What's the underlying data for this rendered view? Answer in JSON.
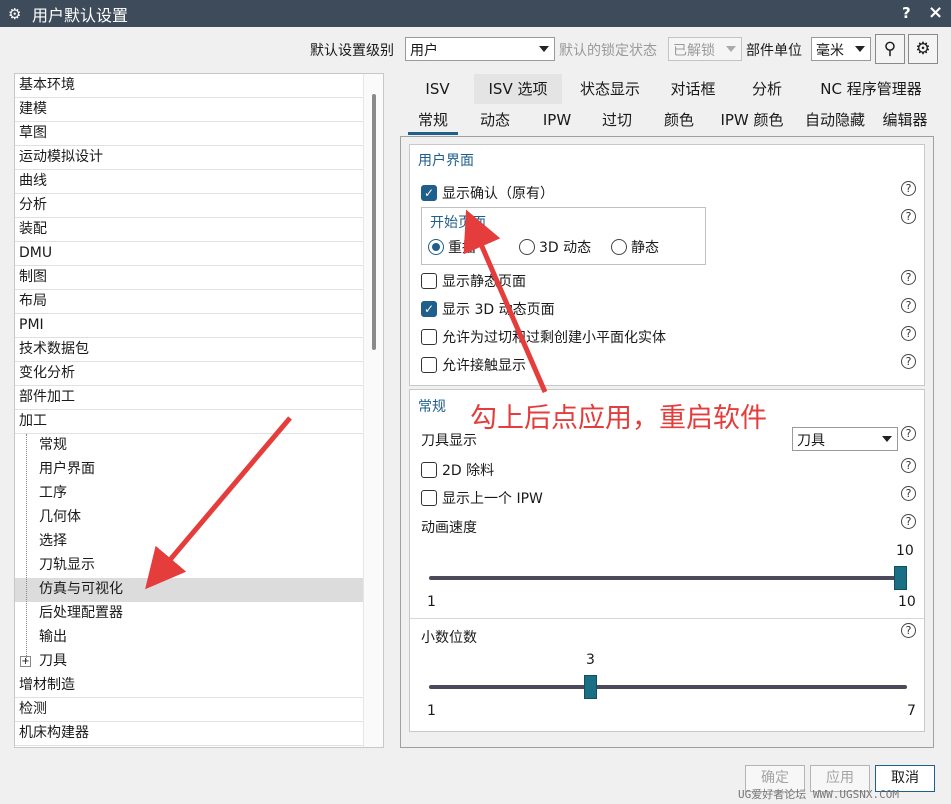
{
  "window": {
    "title": "用户默认设置",
    "help_glyph": "?",
    "close_glyph": "×"
  },
  "toolbar": {
    "level_label": "默认设置级别",
    "level_value": "用户",
    "lock_label": "默认的锁定状态",
    "lock_value": "已解锁",
    "unit_label": "部件单位",
    "unit_value": "毫米"
  },
  "tree": {
    "top_items": [
      "基本环境",
      "建模",
      "草图",
      "运动模拟设计",
      "曲线",
      "分析",
      "装配",
      "DMU",
      "制图",
      "布局",
      "PMI",
      "技术数据包",
      "变化分析",
      "部件加工",
      "加工"
    ],
    "children": [
      "常规",
      "用户界面",
      "工序",
      "几何体",
      "选择",
      "刀轨显示",
      "仿真与可视化",
      "后处理配置器",
      "输出"
    ],
    "tool_item": "刀具",
    "bottom_items": [
      "增材制造",
      "检测",
      "机床构建器"
    ],
    "expander": "+"
  },
  "tabs_row1": [
    "ISV",
    "ISV 选项",
    "状态显示",
    "对话框",
    "分析",
    "NC 程序管理器"
  ],
  "tabs_row2": [
    "常规",
    "动态",
    "IPW",
    "过切",
    "颜色",
    "IPW 颜色",
    "自动隐藏",
    "编辑器"
  ],
  "ui_group": {
    "title": "用户界面",
    "show_confirm": "显示确认（原有）",
    "start_page": "开始页面",
    "radio_redisplay": "重播",
    "radio_3d": "3D 动态",
    "radio_static": "静态",
    "show_static_page": "显示静态页面",
    "show_3d_page": "显示 3D 动态页面",
    "allow_facet": "允许为过切和过剩创建小平面化实体",
    "allow_contact": "允许接触显示"
  },
  "general_group": {
    "title": "常规",
    "tool_display_label": "刀具显示",
    "tool_display_value": "刀具",
    "remove_2d": "2D 除料",
    "show_prev_ipw": "显示上一个 IPW",
    "anim_speed_label": "动画速度",
    "anim_speed_value": "10",
    "anim_speed_min": "1",
    "anim_speed_max": "10",
    "decimals_label": "小数位数",
    "decimals_value": "3",
    "decimals_min": "1",
    "decimals_max": "7"
  },
  "slider_levels": {
    "anim_speed_fraction": 1.0,
    "decimals_fraction": 0.3333
  },
  "help_glyph": "?",
  "checkmark": "✓",
  "buttons": {
    "ok": "确定",
    "apply": "应用",
    "cancel": "取消"
  },
  "annotation": "勾上后点应用，重启软件",
  "watermark": "UG爱好者论坛 WWW.UGSNX.COM",
  "colors": {
    "accent": "#1f5f8b",
    "annotation": "#e53c3c",
    "titlebar": "#3d4b5a"
  }
}
